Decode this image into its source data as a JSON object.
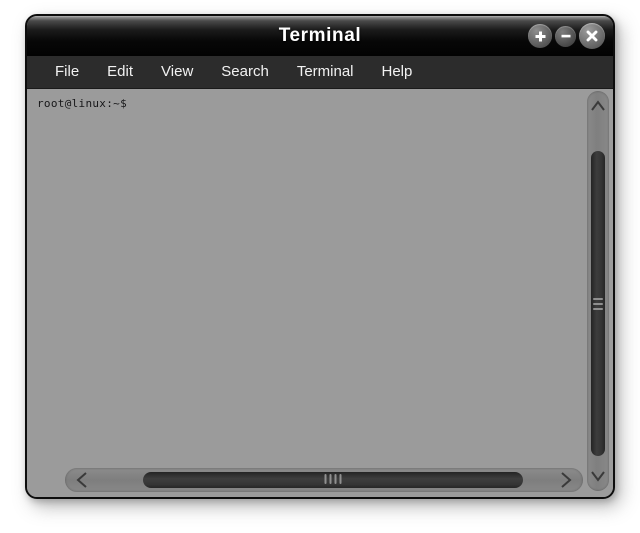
{
  "window": {
    "title": "Terminal",
    "controls": [
      {
        "name": "maximize-button",
        "glyph": "+"
      },
      {
        "name": "minimize-button",
        "glyph": "–"
      },
      {
        "name": "close-button",
        "glyph": "×"
      }
    ],
    "frame_color": "#0d0d0d",
    "titlebar_color": "#070707",
    "menubar_color": "#2c2c2c",
    "body_color": "#9b9b9b"
  },
  "menubar": {
    "items": [
      {
        "label": "File"
      },
      {
        "label": "Edit"
      },
      {
        "label": "View"
      },
      {
        "label": "Search"
      },
      {
        "label": "Terminal"
      },
      {
        "label": "Help"
      }
    ]
  },
  "terminal": {
    "prompt": "root@linux:~$",
    "text_color": "#18181a"
  },
  "scrollbars": {
    "vertical": {
      "up_arrow_icon": "chevron-up-icon",
      "down_arrow_icon": "chevron-down-icon",
      "grip_lines": 3
    },
    "horizontal": {
      "left_arrow_icon": "chevron-left-icon",
      "right_arrow_icon": "chevron-right-icon",
      "grip_lines": 4
    }
  }
}
